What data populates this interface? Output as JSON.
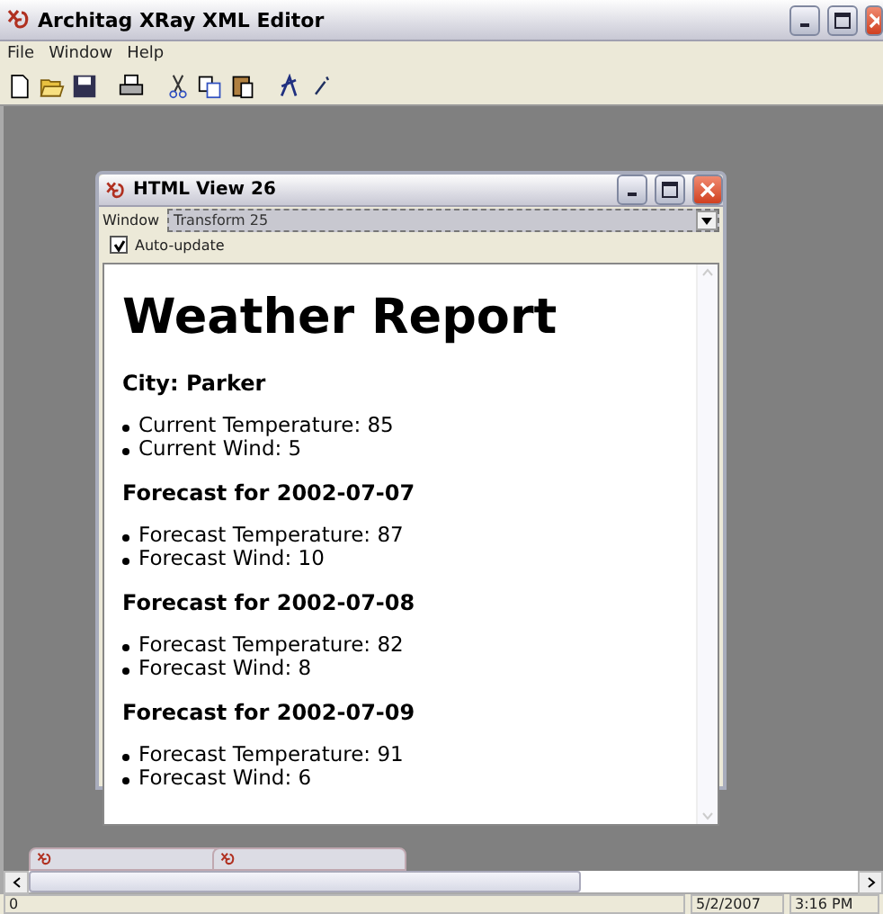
{
  "window": {
    "title": "Architag XRay XML Editor"
  },
  "menu": [
    {
      "label": "File"
    },
    {
      "label": "Window"
    },
    {
      "label": "Help"
    }
  ],
  "html_view": {
    "title": "HTML View 26",
    "window_label": "Window",
    "window_select": "Transform 25",
    "auto_update": {
      "label": "Auto-update",
      "checked": true
    },
    "document": {
      "heading": "Weather Report",
      "sections": [
        {
          "title": "City: Parker",
          "items": [
            "Current Temperature: 85",
            "Current Wind: 5"
          ]
        },
        {
          "title": "Forecast for 2002-07-07",
          "items": [
            "Forecast Temperature: 87",
            "Forecast Wind: 10"
          ]
        },
        {
          "title": "Forecast for 2002-07-08",
          "items": [
            "Forecast Temperature: 82",
            "Forecast Wind: 8"
          ]
        },
        {
          "title": "Forecast for 2002-07-09",
          "items": [
            "Forecast Temperature: 91",
            "Forecast Wind: 6"
          ]
        }
      ]
    }
  },
  "status_bar": [
    "0",
    "5/2/2007",
    "3:16 PM"
  ]
}
